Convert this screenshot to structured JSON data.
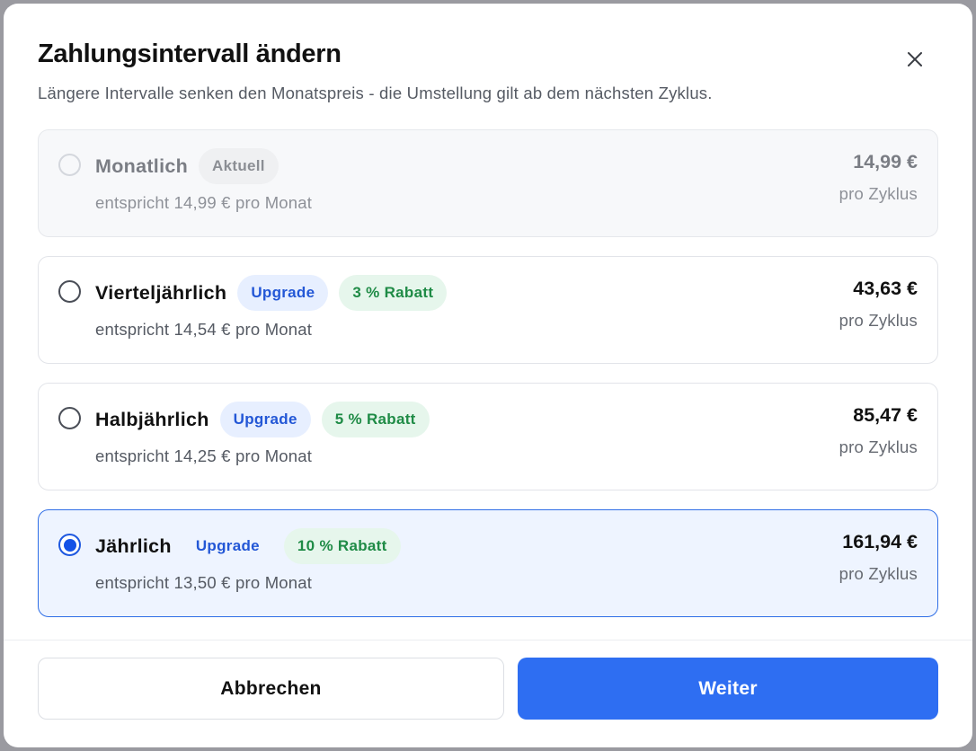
{
  "dialog": {
    "title": "Zahlungsintervall ändern",
    "subtitle": "Längere Intervalle senken den Monatspreis - die Umstellung gilt ab dem nächsten Zyklus.",
    "close_icon": "close-icon"
  },
  "options": [
    {
      "name": "Monatlich",
      "badge_current": "Aktuell",
      "monthly": "entspricht 14,99 € pro Monat",
      "price": "14,99 €",
      "per": "pro Zyklus",
      "selected": false,
      "state": "current"
    },
    {
      "name": "Vierteljährlich",
      "badge_upgrade": "Upgrade",
      "badge_discount": "3 % Rabatt",
      "monthly": "entspricht 14,54 € pro Monat",
      "price": "43,63 €",
      "per": "pro Zyklus",
      "selected": false
    },
    {
      "name": "Halbjährlich",
      "badge_upgrade": "Upgrade",
      "badge_discount": "5 % Rabatt",
      "monthly": "entspricht 14,25 € pro Monat",
      "price": "85,47 €",
      "per": "pro Zyklus",
      "selected": false
    },
    {
      "name": "Jährlich",
      "badge_upgrade": "Upgrade",
      "badge_discount": "10 % Rabatt",
      "monthly": "entspricht 13,50 € pro Monat",
      "price": "161,94 €",
      "per": "pro Zyklus",
      "selected": true
    }
  ],
  "footer": {
    "cancel_label": "Abbrechen",
    "next_label": "Weiter"
  },
  "colors": {
    "accent": "#2e6ef2",
    "radio_selected": "#1452e6",
    "upgrade_text": "#2357d6",
    "discount_text": "#1f8b46"
  }
}
